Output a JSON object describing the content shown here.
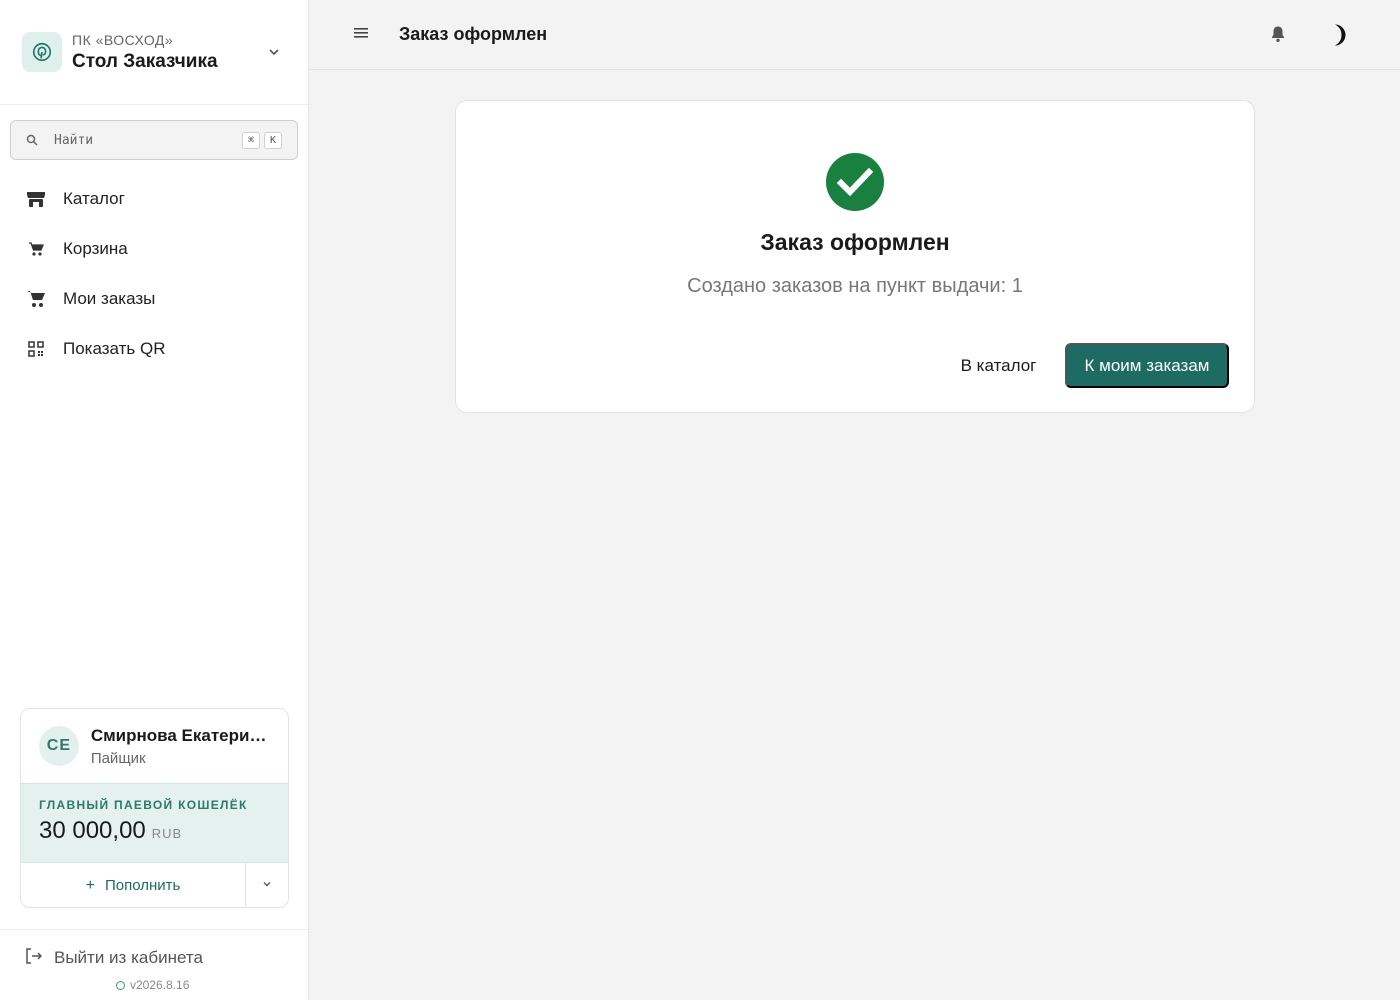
{
  "org": {
    "subtitle": "ПК «ВОСХОД»",
    "name": "Стол Заказчика"
  },
  "search": {
    "placeholder": "Найти",
    "shortcut_key1": "⌘",
    "shortcut_key2": "K"
  },
  "nav": {
    "items": [
      {
        "label": "Каталог",
        "icon": "store-icon"
      },
      {
        "label": "Корзина",
        "icon": "cart-icon"
      },
      {
        "label": "Мои заказы",
        "icon": "shopping-cart-icon"
      },
      {
        "label": "Показать QR",
        "icon": "qr-code-icon"
      }
    ]
  },
  "user": {
    "initials": "СЕ",
    "name": "Смирнова Екатерин…",
    "role": "Пайщик"
  },
  "wallet": {
    "title": "ГЛАВНЫЙ ПАЕВОЙ КОШЕЛЁК",
    "amount": "30 000,00",
    "currency": "RUB",
    "topup_label": "Пополнить"
  },
  "footer": {
    "logout_label": "Выйти из кабинета",
    "version": "v2026.8.16"
  },
  "header": {
    "title": "Заказ оформлен"
  },
  "confirmation": {
    "title": "Заказ оформлен",
    "message": "Создано заказов на пункт выдачи: 1",
    "catalog_button": "В каталог",
    "orders_button": "К моим заказам"
  },
  "colors": {
    "accent": "#1d6b62",
    "success": "#1a8040",
    "wallet_bg": "#e5f1ee"
  }
}
